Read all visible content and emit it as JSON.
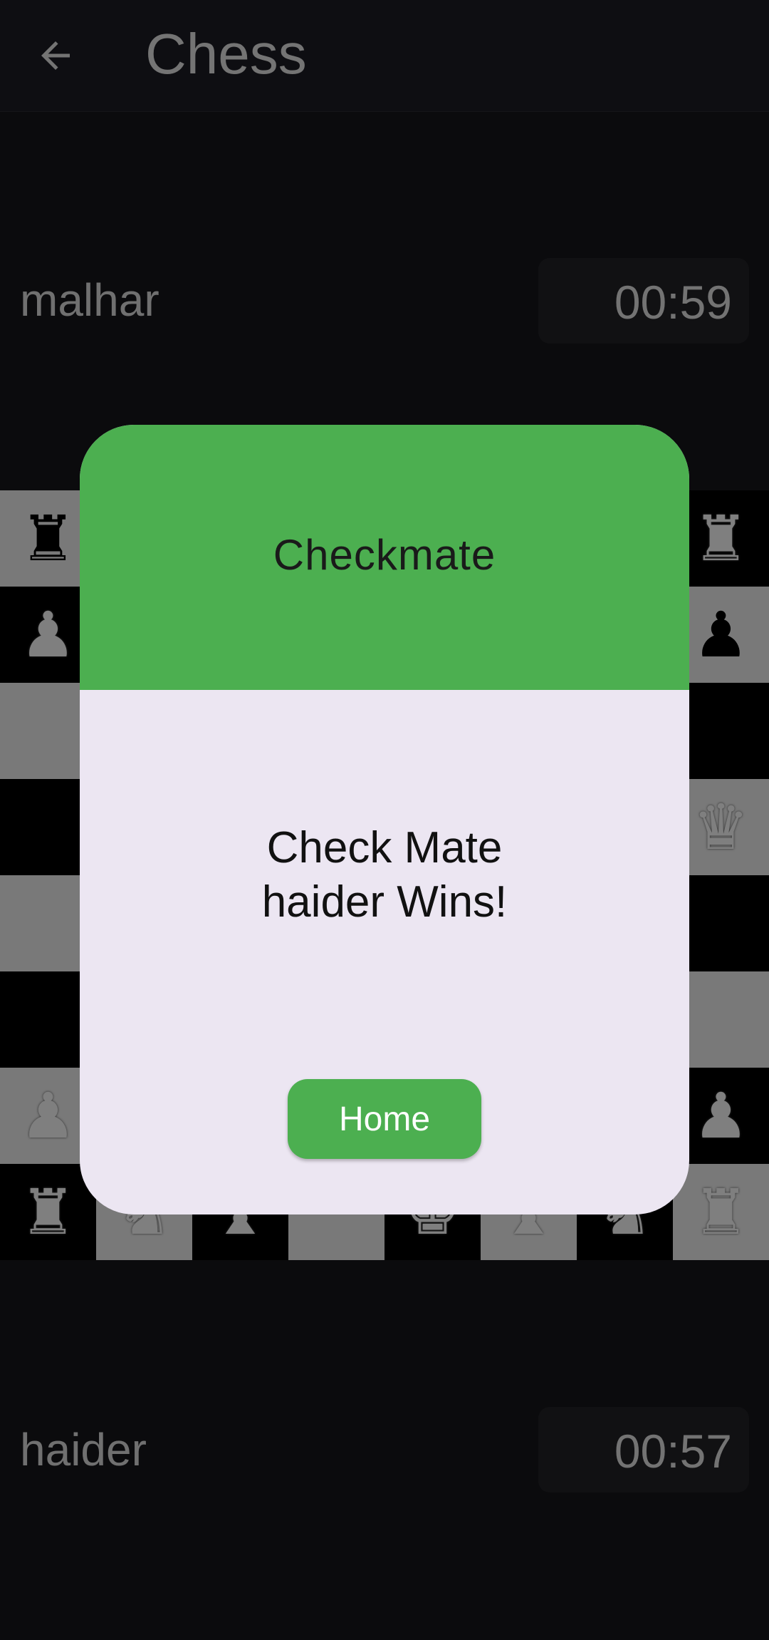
{
  "appbar": {
    "title": "Chess",
    "back_icon": "arrow-left-icon"
  },
  "top_player": {
    "name": "malhar",
    "timer": "00:59"
  },
  "bottom_player": {
    "name": "haider",
    "timer": "00:57"
  },
  "board": {
    "colors": {
      "light": "#f2f2f2",
      "dark": "#000000"
    },
    "pieces": [
      {
        "square": "a8",
        "piece": "rook",
        "side": "black"
      },
      {
        "square": "h8",
        "piece": "rook",
        "side": "white"
      },
      {
        "square": "a7",
        "piece": "pawn",
        "side": "white"
      },
      {
        "square": "h7",
        "piece": "pawn",
        "side": "black"
      },
      {
        "square": "h5",
        "piece": "queen",
        "side": "white"
      },
      {
        "square": "a2",
        "piece": "pawn",
        "side": "white"
      },
      {
        "square": "h2",
        "piece": "pawn",
        "side": "white"
      },
      {
        "square": "a1",
        "piece": "rook",
        "side": "white"
      },
      {
        "square": "b1",
        "piece": "knight",
        "side": "white"
      },
      {
        "square": "c1",
        "piece": "bishop",
        "side": "white"
      },
      {
        "square": "e1",
        "piece": "king",
        "side": "white"
      },
      {
        "square": "f1",
        "piece": "bishop",
        "side": "white"
      },
      {
        "square": "g1",
        "piece": "knight",
        "side": "white"
      },
      {
        "square": "h1",
        "piece": "rook",
        "side": "white"
      }
    ]
  },
  "dialog": {
    "title": "Checkmate",
    "message_line1": "Check Mate",
    "message_line2": "haider Wins!",
    "home_label": "Home",
    "accent": "#4caf50"
  }
}
